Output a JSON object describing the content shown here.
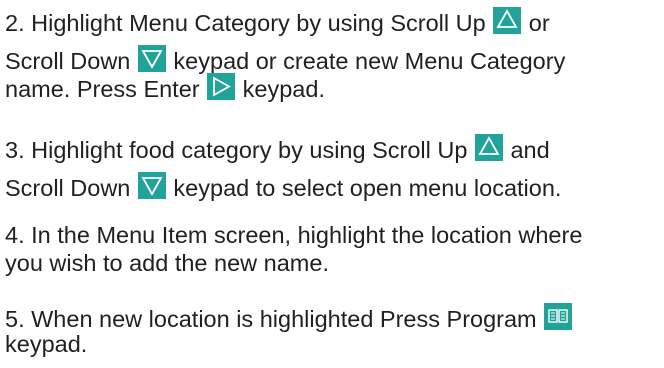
{
  "steps": [
    {
      "lines": [
        [
          "2. Highlight Menu Category by using Scroll Up ",
          " or"
        ],
        [
          "Scroll Down ",
          " keypad or create new Menu Category"
        ],
        [
          "name. Press Enter ",
          " keypad."
        ]
      ]
    },
    {
      "lines": [
        [
          "3. Highlight food category by using Scroll Up ",
          " and"
        ],
        [
          "Scroll Down ",
          " keypad to select open menu location."
        ]
      ]
    },
    {
      "lines": [
        [
          "4. In the Menu Item screen, highlight the location where"
        ],
        [
          "you wish to add the new name."
        ]
      ]
    },
    {
      "lines": [
        [
          "5. When new location is highlighted Press Program ",
          ""
        ],
        [
          "keypad."
        ]
      ]
    }
  ],
  "keys": {
    "scroll_up": {
      "icon": "triangle-up-icon",
      "bg": "#22a39a",
      "glyph": "#ffffff"
    },
    "scroll_down": {
      "icon": "triangle-down-icon",
      "bg": "#22a39a",
      "glyph": "#ffffff"
    },
    "enter": {
      "icon": "triangle-right-icon",
      "bg": "#22a39a",
      "glyph": "#ffffff"
    },
    "program": {
      "icon": "book-icon",
      "bg": "#22a39a",
      "glyph": "#ffffff"
    }
  }
}
